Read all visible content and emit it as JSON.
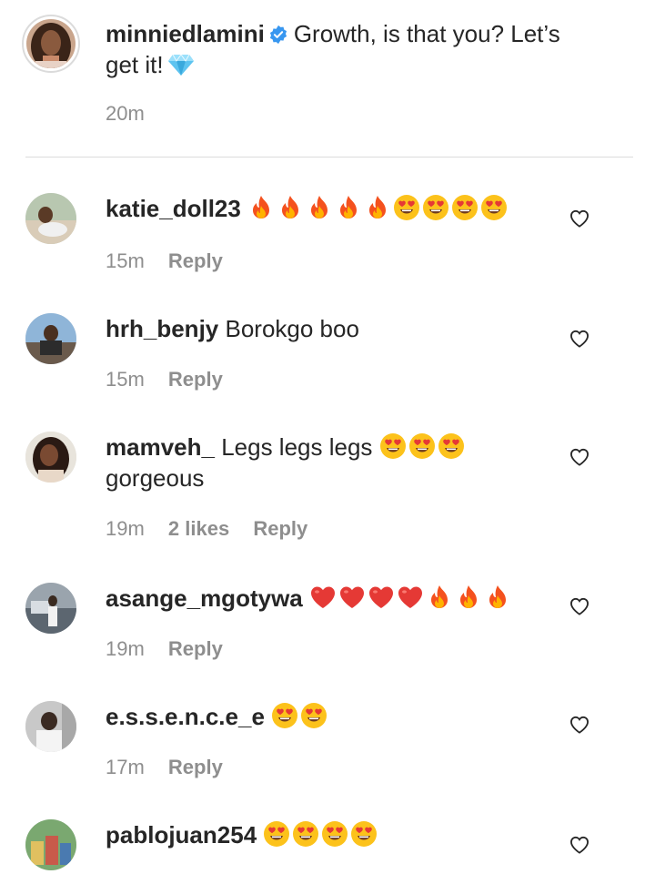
{
  "caption": {
    "username": "minniedlamini",
    "text_line1": "Growth, is that you? Let’s",
    "text_line2": "get it!",
    "time": "20m",
    "verified_icon": "verified-badge-icon",
    "emoji": "gem-stone-emoji"
  },
  "comments": [
    {
      "username": "katie_doll23",
      "text": "",
      "emojis": [
        "fire",
        "fire",
        "fire",
        "fire",
        "fire",
        "heart-eyes",
        "heart-eyes",
        "heart-eyes",
        "heart-eyes"
      ],
      "time": "15m",
      "likes": "",
      "reply": "Reply"
    },
    {
      "username": "hrh_benjy",
      "text": "Borokgo boo",
      "emojis": [],
      "time": "15m",
      "likes": "",
      "reply": "Reply"
    },
    {
      "username": "mamveh_",
      "text": "Legs legs legs",
      "text_line2": "gorgeous",
      "emojis": [
        "heart-eyes",
        "heart-eyes",
        "heart-eyes"
      ],
      "time": "19m",
      "likes": "2 likes",
      "reply": "Reply"
    },
    {
      "username": "asange_mgotywa",
      "text": "",
      "emojis": [
        "red-heart",
        "red-heart",
        "red-heart",
        "red-heart",
        "fire",
        "fire",
        "fire"
      ],
      "time": "19m",
      "likes": "",
      "reply": "Reply"
    },
    {
      "username": "e.s.s.e.n.c.e_e",
      "text": "",
      "emojis": [
        "heart-eyes",
        "heart-eyes"
      ],
      "time": "17m",
      "likes": "",
      "reply": "Reply"
    },
    {
      "username": "pablojuan254",
      "text": "",
      "emojis": [
        "heart-eyes",
        "heart-eyes",
        "heart-eyes",
        "heart-eyes"
      ],
      "time": "",
      "likes": "",
      "reply": ""
    }
  ],
  "colors": {
    "text": "#262626",
    "secondary": "#8e8e8e",
    "divider": "#dbdbdb",
    "verified": "#3897f0"
  }
}
